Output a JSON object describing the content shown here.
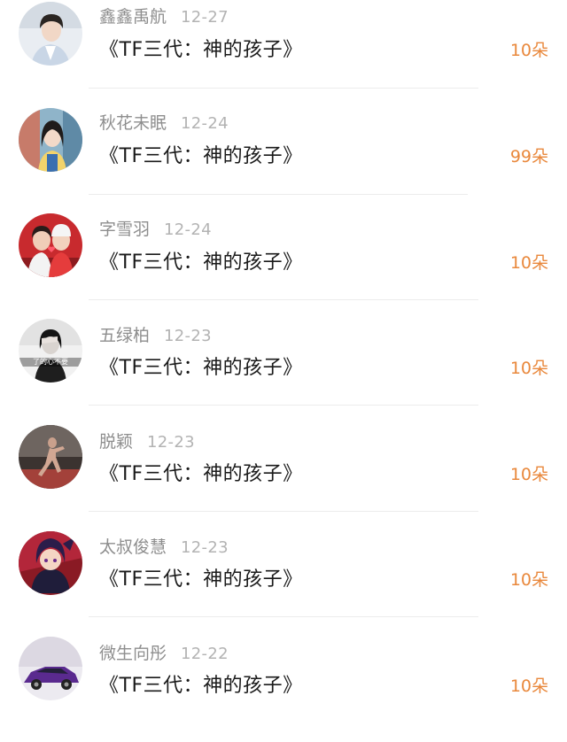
{
  "rows": [
    {
      "name": "鑫鑫禹航",
      "date": "12-27",
      "gift": "《TF三代：神的孩子》",
      "count": "10朵",
      "avatar": "avatar-boy-suit"
    },
    {
      "name": "秋花未眠",
      "date": "12-24",
      "gift": "《TF三代：神的孩子》",
      "count": "99朵",
      "avatar": "avatar-girl-blue"
    },
    {
      "name": "字雪羽",
      "date": "12-24",
      "gift": "《TF三代：神的孩子》",
      "count": "10朵",
      "avatar": "avatar-couple-red"
    },
    {
      "name": "五绿柏",
      "date": "12-23",
      "gift": "《TF三代：神的孩子》",
      "count": "10朵",
      "avatar": "avatar-girl-bw"
    },
    {
      "name": "脱颖",
      "date": "12-23",
      "gift": "《TF三代：神的孩子》",
      "count": "10朵",
      "avatar": "avatar-runner-dark"
    },
    {
      "name": "太叔俊慧",
      "date": "12-23",
      "gift": "《TF三代：神的孩子》",
      "count": "10朵",
      "avatar": "avatar-anime-red"
    },
    {
      "name": "微生向彤",
      "date": "12-22",
      "gift": "《TF三代：神的孩子》",
      "count": "10朵",
      "avatar": "avatar-car-purple"
    }
  ],
  "avatar4_caption": "了的心不要",
  "colors": {
    "count": "#e9883c",
    "name": "#8e8e8e",
    "date": "#b3b3b3",
    "gift": "#1a1a1a",
    "divider": "#ececec"
  }
}
